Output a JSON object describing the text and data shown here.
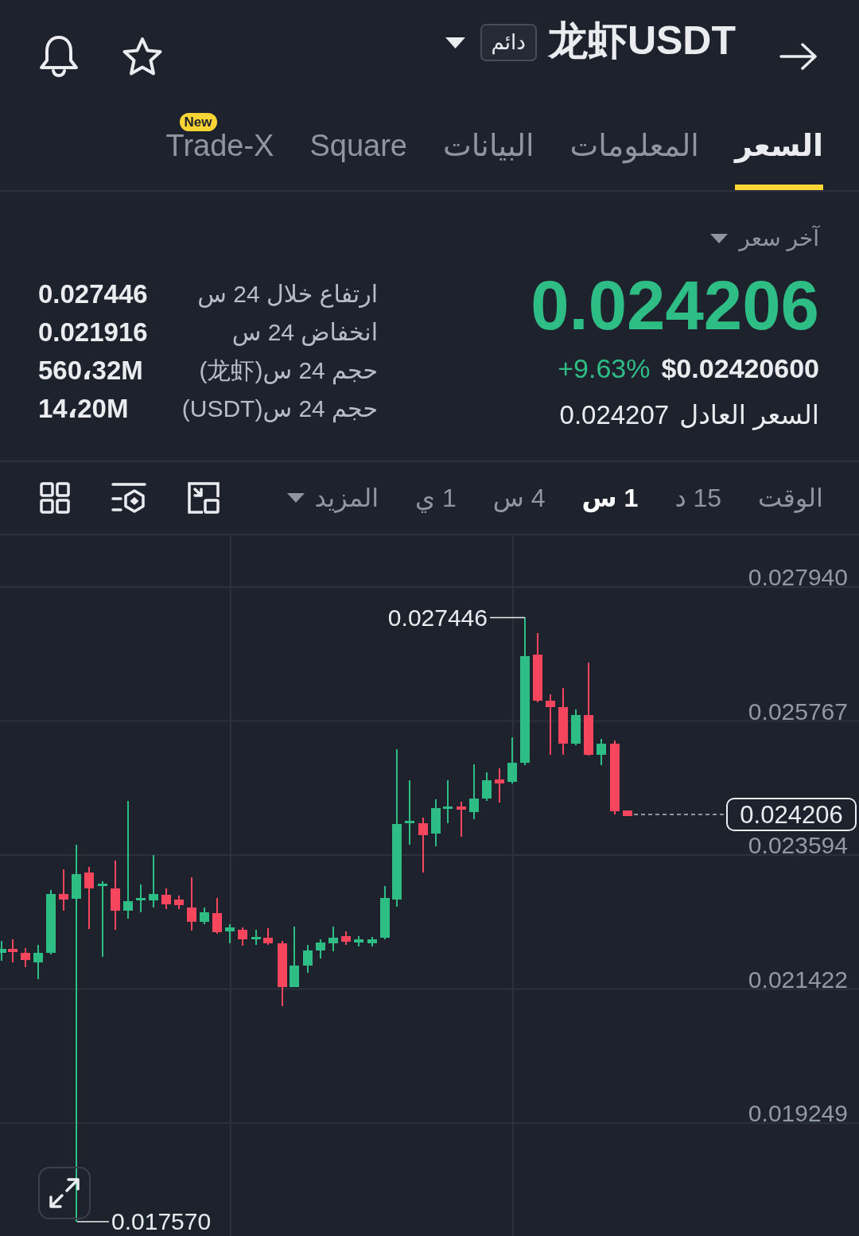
{
  "header": {
    "title": "龙虾USDT",
    "badge": "دائم"
  },
  "tabs": [
    {
      "label": "السعر",
      "selected": true
    },
    {
      "label": "المعلومات",
      "selected": false
    },
    {
      "label": "البيانات",
      "selected": false
    },
    {
      "label": "Square",
      "selected": false
    },
    {
      "label": "Trade-X",
      "selected": false,
      "badge": "New"
    }
  ],
  "price_panel": {
    "label": "آخر سعر",
    "last_price": "0.024206",
    "usd_price": "$0.02420600",
    "change": "+9.63%",
    "fair_price_label": "السعر العادل",
    "fair_price": "0.024207"
  },
  "stats_24h": [
    {
      "label": "ارتفاع خلال 24 س",
      "value": "0.027446"
    },
    {
      "label": "انخفاض 24 س",
      "value": "0.021916"
    },
    {
      "label": "حجم 24 س(龙虾)",
      "value": "560،32M"
    },
    {
      "label": "حجم 24 س(USDT)",
      "value": "14،20M"
    }
  ],
  "timeframes": {
    "label": "الوقت",
    "intervals": [
      {
        "label": "15 د",
        "selected": false
      },
      {
        "label": "1 س",
        "selected": true
      },
      {
        "label": "4 س",
        "selected": false
      },
      {
        "label": "1 ي",
        "selected": false
      }
    ],
    "more": "المزيد"
  },
  "chart": {
    "price_axis": [
      "0.027940",
      "0.025767",
      "0.023594",
      "0.021422",
      "0.019249"
    ],
    "current_price": "0.024206",
    "high_label": "0.027446",
    "low_label": "0.017570"
  }
}
